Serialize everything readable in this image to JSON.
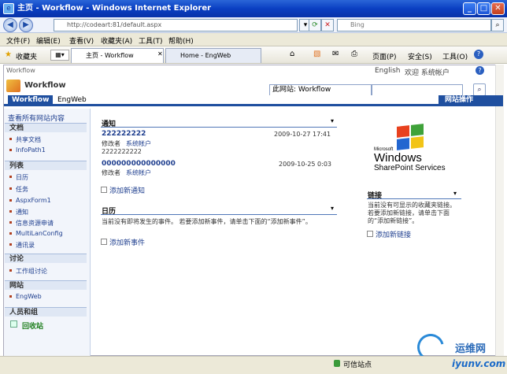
{
  "window": {
    "title": "主页 - Workflow - Windows Internet Explorer",
    "minimize": "_",
    "maximize": "□",
    "close": "✕"
  },
  "address": {
    "url": "http://codeart:81/default.aspx",
    "search_placeholder": "Bing"
  },
  "menu": {
    "items": [
      "文件(F)",
      "编辑(E)",
      "查看(V)",
      "收藏夹(A)",
      "工具(T)",
      "帮助(H)"
    ]
  },
  "favorites": {
    "label": "收藏夹",
    "tabs": [
      "主页 - Workflow",
      "Home - EngWeb"
    ],
    "tools": [
      "页面(P)",
      "安全(S)",
      "工具(O)"
    ]
  },
  "page": {
    "breadcrumb": "Workflow",
    "english": "English",
    "welcome": "欢迎 系统帐户",
    "site_title": "Workflow",
    "search_scope": "此网站: Workflow",
    "nav_tabs": [
      "Workflow",
      "EngWeb"
    ],
    "site_actions": "网站操作"
  },
  "leftnav": {
    "view_all": "查看所有网站内容",
    "sections": [
      {
        "title": "文档",
        "items": [
          "共享文档",
          "InfoPath1"
        ]
      },
      {
        "title": "列表",
        "items": [
          "日历",
          "任务",
          "AspxForm1",
          "通知",
          "信息资源申请",
          "MultiLanConfig",
          "通讯录"
        ]
      },
      {
        "title": "讨论",
        "items": [
          "工作组讨论"
        ]
      },
      {
        "title": "网站",
        "items": [
          "EngWeb"
        ]
      },
      {
        "title": "人员和组",
        "items": []
      }
    ],
    "recycle": "回收站"
  },
  "announcements": {
    "title": "通知",
    "items": [
      {
        "title": "222222222",
        "date": "2009-10-27 17:41",
        "modified_label": "修改者",
        "modified_by": "系统帐户",
        "body": "2222222222"
      },
      {
        "title": "000000000000000",
        "date": "2009-10-25 0:03",
        "modified_label": "修改者",
        "modified_by": "系统帐户",
        "body": ""
      }
    ],
    "add": "添加新通知"
  },
  "calendar": {
    "title": "日历",
    "empty": "当前没有即将发生的事件。 若要添加新事件，请单击下面的“添加新事件”。",
    "add": "添加新事件"
  },
  "links": {
    "title": "链接",
    "empty": "当前没有可显示的收藏夹链接。 若要添加新链接，请单击下面的“添加新链接”。",
    "add": "添加新链接"
  },
  "logo": {
    "line1": "Microsoft",
    "line2": "Windows",
    "line3": "SharePoint Services"
  },
  "status": {
    "zone": "可信站点",
    "watermark": "运维网",
    "watermark_url": "iyunv.com"
  }
}
